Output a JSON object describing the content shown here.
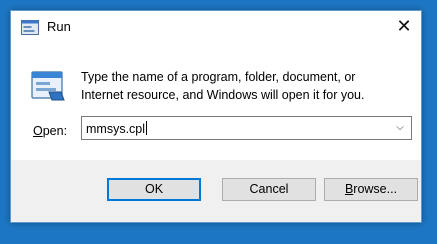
{
  "window": {
    "title": "Run",
    "close_glyph": "✕",
    "app_icon": "run-icon"
  },
  "dialog": {
    "description": "Type the name of a program, folder, document, or Internet resource, and Windows will open it for you.",
    "open_label_accesskey": "O",
    "open_label_rest": "pen:",
    "open_value": "mmsys.cpl",
    "dropdown_glyph": "⌵"
  },
  "buttons": {
    "ok": "OK",
    "cancel": "Cancel",
    "browse_accesskey": "B",
    "browse_rest": "rowse..."
  },
  "colors": {
    "desktop": "#1d76c3",
    "accent": "#0078d7",
    "footer": "#f0f0f0"
  }
}
